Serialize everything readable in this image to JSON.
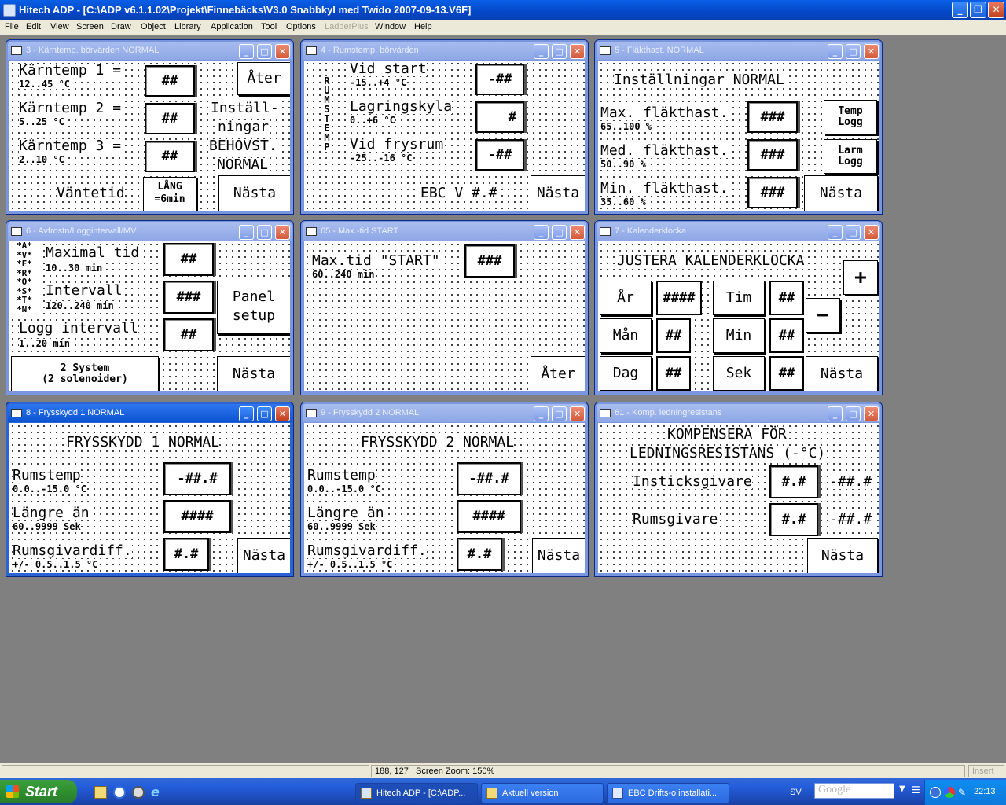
{
  "app": {
    "title": "Hitech ADP - [C:\\ADP v6.1.1.02\\Projekt\\Finnebäcks\\V3.0 Snabbkyl med Twido 2007-09-13.V6F]"
  },
  "menu": [
    "File",
    "Edit",
    "View",
    "Screen",
    "Draw",
    "Object",
    "Library",
    "Application",
    "Tool",
    "Options",
    "LadderPlus",
    "Window",
    "Help"
  ],
  "panels": {
    "p3": {
      "title": "3 - Kärntemp. börvärden NORMAL",
      "l1": "Kärntemp 1 =",
      "r1": "12..45 °C",
      "l2": "Kärntemp 2 =",
      "r2": "5..25 °C",
      "l3": "Kärntemp 3 =",
      "r3": "2..10 °C",
      "f1": "##",
      "f2": "##",
      "f3": "##",
      "back": "Åter",
      "inst1": "Inställ-",
      "inst2": "ningar",
      "inst3": "BEHOVST.",
      "inst4": "NORMAL",
      "wait": "Väntetid",
      "lang1": "LÅNG",
      "lang2": "=6min",
      "next": "Nästa"
    },
    "p4": {
      "title": "4 - Rumstemp. börvärden",
      "vert": [
        "R",
        "U",
        "M",
        "S",
        "T",
        "E",
        "M",
        "P"
      ],
      "l1": "Vid start",
      "r1": "-15..+4 °C",
      "l2": "Lagringskyla",
      "r2": "0..+6 °C",
      "l3": "Vid frysrum",
      "r3": "-25..-16 °C",
      "f1": "-##",
      "f2": "#",
      "f3": "-##",
      "ebc": "EBC V #.#",
      "next": "Nästa"
    },
    "p5": {
      "title": "5 - Fläkthast. NORMAL",
      "head": "Inställningar NORMAL",
      "l1": "Max. fläkthast.",
      "r1": "65..100 %",
      "l2": "Med. fläkthast.",
      "r2": "50..90 %",
      "l3": "Min. fläkthast.",
      "r3": "35..60 %",
      "f1": "###",
      "f2": "###",
      "f3": "###",
      "temp1": "Temp",
      "temp2": "Logg",
      "larm1": "Larm",
      "larm2": "Logg",
      "next": "Nästa"
    },
    "p6": {
      "title": "6 - Avfrostn/Loggintervall/MV",
      "vert": [
        "*A*",
        "*V*",
        "*F*",
        "*R*",
        "*O*",
        "*S*",
        "*T*",
        "*N*"
      ],
      "l1": "Maximal tid",
      "r1": "10..30 min",
      "l2": "Intervall",
      "r2": "120..240 min",
      "l3": "Logg intervall",
      "r3": "1..20 min",
      "f1": "##",
      "f2": "###",
      "f3": "##",
      "panel1": "Panel",
      "panel2": "setup",
      "sys1": "2 System",
      "sys2": "(2 solenoider)",
      "next": "Nästa"
    },
    "p65": {
      "title": "65 - Max.-tid START",
      "l1": "Max.tid \"START\"",
      "r1": "60..240 min",
      "f1": "###",
      "back": "Åter"
    },
    "p7": {
      "title": "7 - Kalenderklocka",
      "head": "JUSTERA KALENDERKLOCKA",
      "plus": "+",
      "minus": "−",
      "year": "År",
      "yearv": "####",
      "month": "Mån",
      "monthv": "##",
      "day": "Dag",
      "dayv": "##",
      "hour": "Tim",
      "hourv": "##",
      "min": "Min",
      "minv": "##",
      "sec": "Sek",
      "secv": "##",
      "next": "Nästa"
    },
    "p8": {
      "title": "8 - Frysskydd 1 NORMAL",
      "head": "FRYSSKYDD 1 NORMAL",
      "l1": "Rumstemp",
      "r1": "0.0..-15.0 °C",
      "l2": "Längre än",
      "r2": "60..9999 Sek",
      "l3": "Rumsgivardiff.",
      "r3": "+/- 0.5..1.5 °C",
      "f1": "-##.#",
      "f2": "####",
      "f3": "#.#",
      "next": "Nästa"
    },
    "p9": {
      "title": "9 - Frysskydd 2 NORMAL",
      "head": "FRYSSKYDD 2 NORMAL",
      "l1": "Rumstemp",
      "r1": "0.0..-15.0 °C",
      "l2": "Längre än",
      "r2": "60..9999 Sek",
      "l3": "Rumsgivardiff.",
      "r3": "+/- 0.5..1.5 °C",
      "f1": "-##.#",
      "f2": "####",
      "f3": "#.#",
      "next": "Nästa"
    },
    "p61": {
      "title": "61 - Komp. ledningresistans",
      "head1": "KOMPENSERA FÖR",
      "head2": "LEDNINGSRESISTANS (-°C)",
      "l1": "Insticksgivare",
      "l2": "Rumsgivare",
      "f1": "#.#",
      "f2": "#.#",
      "v1": "-##.#",
      "v2": "-##.#",
      "next": "Nästa"
    }
  },
  "status": {
    "coords": "188, 127",
    "zoom": "Screen Zoom: 150%",
    "mode": "Insert"
  },
  "taskbar": {
    "start": "Start",
    "t1": "Hitech ADP - [C:\\ADP...",
    "t2": "Aktuell version",
    "t3": "EBC Drifts-o installati...",
    "lang": "SV",
    "search": "Google",
    "clock": "22:13"
  },
  "colors": {
    "titlebar": "#0a5fe6",
    "desktop": "#808080",
    "start": "#2f8f2f"
  }
}
